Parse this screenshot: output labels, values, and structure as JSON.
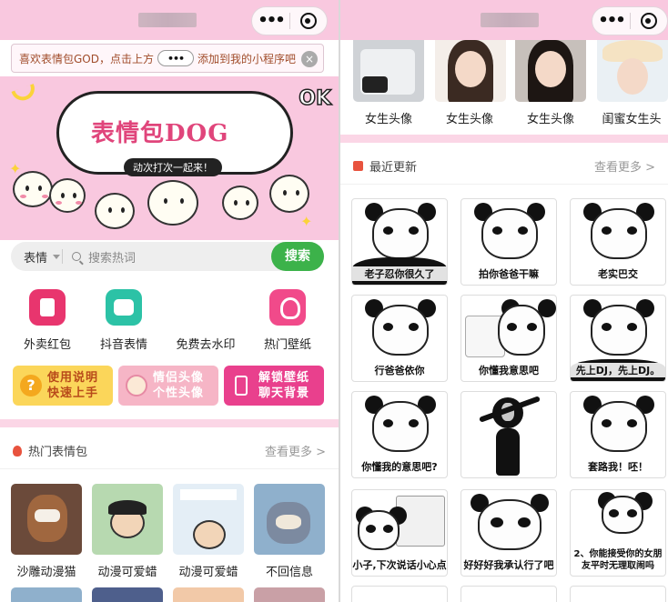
{
  "left": {
    "capsule": {
      "dots": "•••"
    },
    "tip": {
      "before": "喜欢表情包GOD，点击上方",
      "capsule_dots": "•••",
      "after": "添加到我的小程序吧",
      "close": "×"
    },
    "banner": {
      "title": "表情包DOG",
      "subtitle": "动次打次一起来！",
      "ok": "OK"
    },
    "search": {
      "category": "表情",
      "placeholder": "搜索热词",
      "button": "搜索"
    },
    "features": [
      {
        "label": "外卖红包",
        "icon": "red-envelope-icon"
      },
      {
        "label": "抖音表情",
        "icon": "douyin-sticker-icon"
      },
      {
        "label": "免费去水印",
        "icon": ""
      },
      {
        "label": "热门壁纸",
        "icon": "wallpaper-badge-icon"
      }
    ],
    "promos": [
      {
        "line1": "使用说明",
        "line2": "快速上手",
        "icon": "question-icon",
        "icon_glyph": "?"
      },
      {
        "line1": "情侣头像",
        "line2": "个性头像",
        "icon": "couple-avatar-icon",
        "icon_glyph": ""
      },
      {
        "line1": "解锁壁纸",
        "line2": "聊天背景",
        "icon": "phone-icon",
        "icon_glyph": ""
      }
    ],
    "hot_section": {
      "title": "热门表情包",
      "more": "查看更多 >"
    },
    "hot_items": [
      {
        "label": "沙雕动漫猫"
      },
      {
        "label": "动漫可爱蜡"
      },
      {
        "label": "动漫可爱蜡"
      },
      {
        "label": "不回信息"
      }
    ]
  },
  "right": {
    "capsule": {
      "dots": "•••"
    },
    "avatars": [
      {
        "label": "女生头像"
      },
      {
        "label": "女生头像"
      },
      {
        "label": "女生头像"
      },
      {
        "label": "闺蜜女生头"
      }
    ],
    "recent_section": {
      "title": "最近更新",
      "more": "查看更多 >"
    },
    "memes": [
      {
        "caption": "老子忍你很久了"
      },
      {
        "caption": "拍你爸爸干嘛"
      },
      {
        "caption": "老实巴交"
      },
      {
        "caption": "行爸爸依你"
      },
      {
        "caption": "你懂我意思吧"
      },
      {
        "caption": "先上DJ，先上DJ。"
      },
      {
        "caption": "你懂我的意思吧?"
      },
      {
        "caption": ""
      },
      {
        "caption": "套路我！呸！"
      },
      {
        "caption": "小子,下次说话小心点"
      },
      {
        "caption": "好好好我承认行了吧"
      },
      {
        "caption": "2、你能接受你的女朋友平时无理取闹吗"
      }
    ]
  },
  "colors": {
    "pink_bg": "#f9c8df",
    "search_green": "#3cb24a",
    "accent_red": "#e8533e"
  }
}
